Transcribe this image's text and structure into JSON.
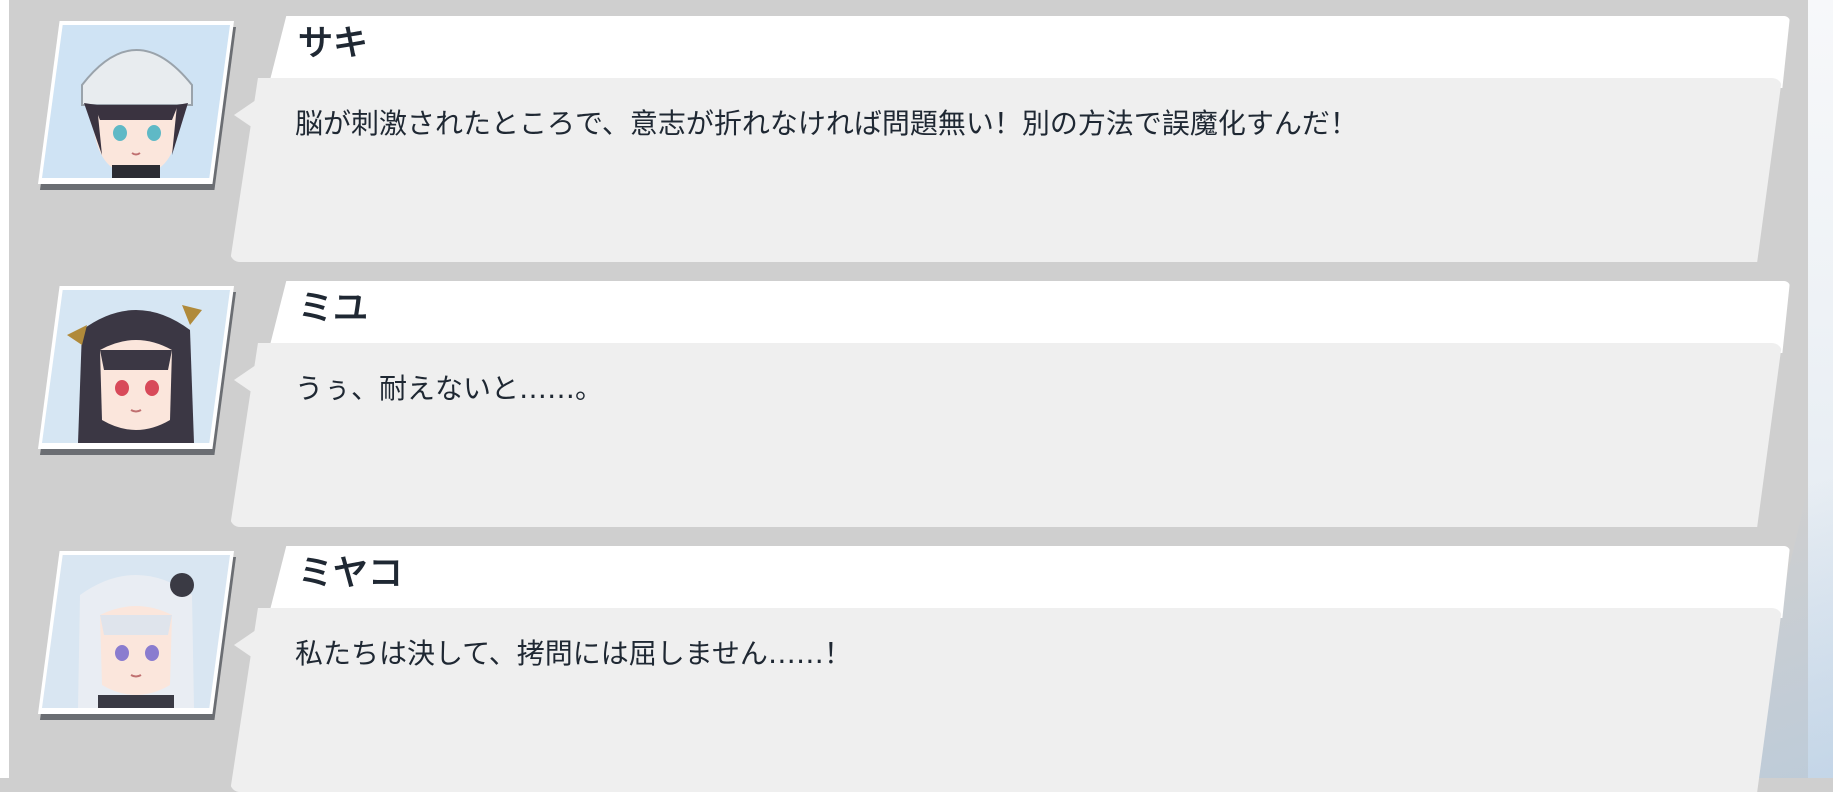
{
  "accent": {
    "name_color": "#1f2833",
    "text_color": "#1f2833",
    "panel_bg": "#cfcfcf"
  },
  "log": [
    {
      "speaker": "サキ",
      "line": "脳が刺激されたところで、意志が折れなければ問題無い！別の方法で誤魔化すんだ！",
      "avatar_icon": "saki-portrait-icon"
    },
    {
      "speaker": "ミユ",
      "line": "うぅ、耐えないと……。",
      "avatar_icon": "miyu-portrait-icon"
    },
    {
      "speaker": "ミヤコ",
      "line": "私たちは決して、拷問には屈しません……！",
      "avatar_icon": "miyako-portrait-icon"
    }
  ]
}
